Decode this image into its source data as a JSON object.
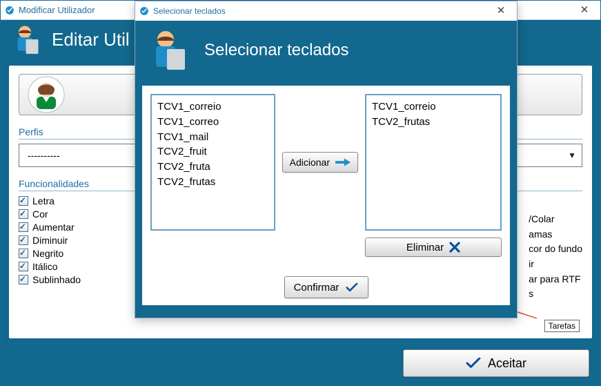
{
  "parent": {
    "title": "Modificar Utilizador",
    "headerTitle": "Editar Util",
    "perfisLabel": "Perfis",
    "perfisValue": "----------",
    "funcLabel": "Funcionalidades",
    "funcCol1": [
      {
        "label": "Letra",
        "checked": true
      },
      {
        "label": "Cor",
        "checked": true
      },
      {
        "label": "Aumentar",
        "checked": true
      },
      {
        "label": "Diminuir",
        "checked": true
      },
      {
        "label": "Negrito",
        "checked": true
      },
      {
        "label": "Itálico",
        "checked": true
      },
      {
        "label": "Sublinhado",
        "checked": true
      }
    ],
    "funcCol2": [
      {
        "label": "/Colar"
      },
      {
        "label": "amas"
      },
      {
        "label": "cor do fundo"
      },
      {
        "label": "ir"
      },
      {
        "label": "ar para RTF"
      },
      {
        "label": "s"
      }
    ],
    "tarefasLabel": "Tarefas",
    "acceptLabel": "Aceitar"
  },
  "modal": {
    "title": "Selecionar teclados",
    "headerTitle": "Selecionar teclados",
    "available": [
      "TCV1_correio",
      "TCV1_correo",
      "TCV1_mail",
      "TCV2_fruit",
      "TCV2_fruta",
      "TCV2_frutas"
    ],
    "selected": [
      "TCV1_correio",
      "TCV2_frutas"
    ],
    "addLabel": "Adicionar",
    "removeLabel": "Eliminar",
    "confirmLabel": "Confirmar"
  }
}
